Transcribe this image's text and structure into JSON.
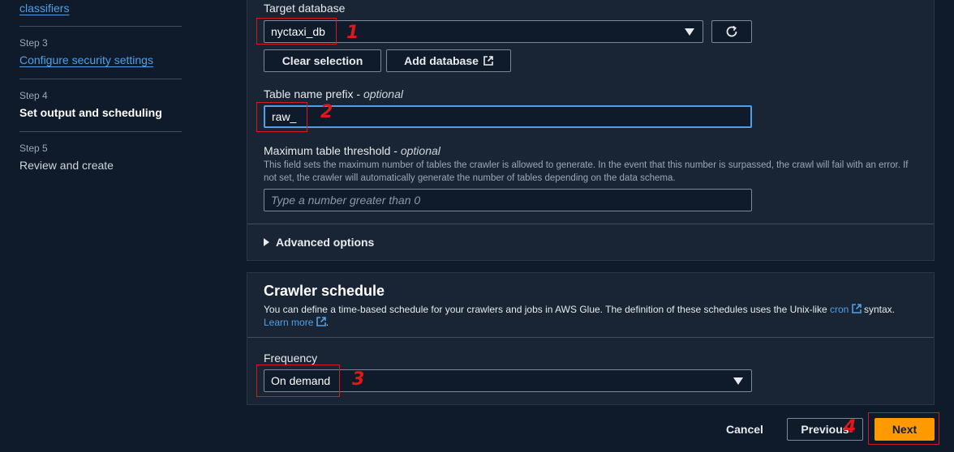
{
  "nav": {
    "step2_title": "classifiers",
    "step3_label": "Step 3",
    "step3_title": "Configure security settings",
    "step4_label": "Step 4",
    "step4_title": "Set output and scheduling",
    "step5_label": "Step 5",
    "step5_title": "Review and create"
  },
  "output": {
    "target_db_label": "Target database",
    "target_db_value": "nyctaxi_db",
    "clear_selection": "Clear selection",
    "add_database": "Add database",
    "prefix_label": "Table name prefix - ",
    "optional": "optional",
    "prefix_value": "raw_",
    "threshold_label": "Maximum table threshold - ",
    "threshold_desc": "This field sets the maximum number of tables the crawler is allowed to generate. In the event that this number is surpassed, the crawl will fail with an error. If not set, the crawler will automatically generate the number of tables depending on the data schema.",
    "threshold_placeholder": "Type a number greater than 0",
    "advanced": "Advanced options"
  },
  "schedule": {
    "title": "Crawler schedule",
    "desc_pre": "You can define a time-based schedule for your crawlers and jobs in AWS Glue. The definition of these schedules uses the Unix-like",
    "cron_link": "cron",
    "desc_post": "syntax.",
    "learn_more": "Learn more",
    "frequency_label": "Frequency",
    "frequency_value": "On demand"
  },
  "footer": {
    "cancel": "Cancel",
    "previous": "Previous",
    "next": "Next"
  },
  "annotations": [
    "1",
    "2",
    "3",
    "4"
  ],
  "colors": {
    "accent": "#539fe5",
    "primary_button": "#ff9900",
    "annotation": "#e01818"
  }
}
